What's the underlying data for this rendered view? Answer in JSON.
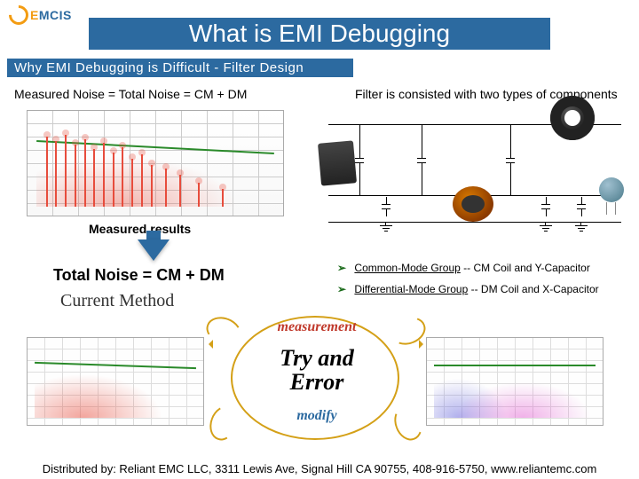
{
  "logo": {
    "brand_e": "E",
    "brand_rest": "MCIS"
  },
  "title": "What is EMI Debugging",
  "subtitle": "Why EMI Debugging is Difficult  -  Filter Design",
  "left_caption": "Measured Noise = Total Noise = CM + DM",
  "right_caption": "Filter is consisted with two types of components",
  "measured_results": "Measured results",
  "formula": "Total Noise = CM + DM",
  "current_method": "Current Method",
  "bullets": {
    "bp": "➢",
    "line1_a": "Common-Mode Group",
    "line1_b": "  -- CM Coil and Y-Capacitor",
    "line2_a": "Differential-Mode Group",
    "line2_b": " -- DM Coil and X-Capacitor"
  },
  "ann": {
    "measurement": "measurement",
    "try_error": "Try and\nError",
    "modify": "modify"
  },
  "footer": "Distributed by: Reliant EMC LLC, 3311 Lewis Ave, Signal Hill CA 90755, 408-916-5750, www.reliantemc.com"
}
